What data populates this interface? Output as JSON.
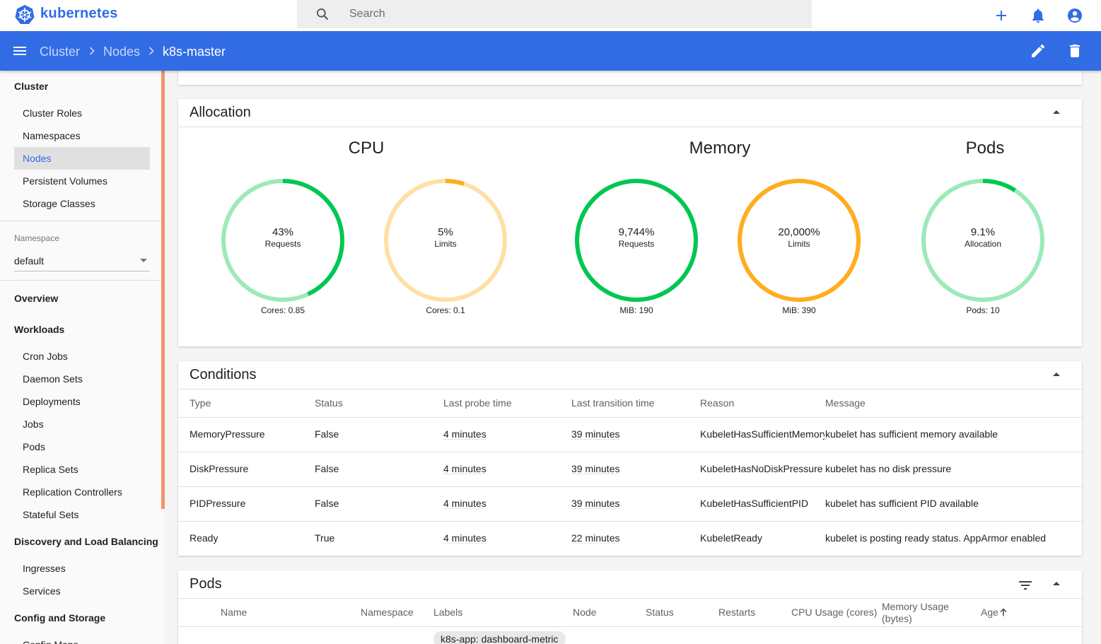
{
  "app": {
    "name": "kubernetes",
    "brand_color": "#326ce5"
  },
  "search": {
    "placeholder": "Search"
  },
  "topbar_icons": [
    "plus-icon",
    "bell-icon",
    "account-icon"
  ],
  "breadcrumb": {
    "items": [
      "Cluster",
      "Nodes"
    ],
    "current": "k8s-master"
  },
  "actions": [
    "edit-icon",
    "delete-icon"
  ],
  "sidebar": {
    "cluster": {
      "heading": "Cluster",
      "items": [
        "Cluster Roles",
        "Namespaces",
        "Nodes",
        "Persistent Volumes",
        "Storage Classes"
      ],
      "active": "Nodes"
    },
    "namespace": {
      "label": "Namespace",
      "value": "default"
    },
    "overview": "Overview",
    "workloads": {
      "heading": "Workloads",
      "items": [
        "Cron Jobs",
        "Daemon Sets",
        "Deployments",
        "Jobs",
        "Pods",
        "Replica Sets",
        "Replication Controllers",
        "Stateful Sets"
      ]
    },
    "discovery": {
      "heading": "Discovery and Load Balancing",
      "items": [
        "Ingresses",
        "Services"
      ]
    },
    "config": {
      "heading": "Config and Storage",
      "items": [
        "Config Maps"
      ]
    }
  },
  "allocation": {
    "title": "Allocation",
    "groups": [
      "CPU",
      "Memory",
      "Pods"
    ],
    "gauges": [
      {
        "value": "43%",
        "label": "Requests",
        "footer": "Cores: 0.85",
        "fraction": 0.43,
        "color": "#00c752",
        "track": "#9de9b9"
      },
      {
        "value": "5%",
        "label": "Limits",
        "footer": "Cores: 0.1",
        "fraction": 0.05,
        "color": "#ffad20",
        "track": "#ffdfa6"
      },
      {
        "value": "9,744%",
        "label": "Requests",
        "footer": "MiB: 190",
        "fraction": 1.0,
        "color": "#00c752",
        "track": "#9de9b9"
      },
      {
        "value": "20,000%",
        "label": "Limits",
        "footer": "MiB: 390",
        "fraction": 1.0,
        "color": "#ffad20",
        "track": "#ffdfa6"
      },
      {
        "value": "9.1%",
        "label": "Allocation",
        "footer": "Pods: 10",
        "fraction": 0.091,
        "color": "#00c752",
        "track": "#9de9b9"
      }
    ]
  },
  "conditions": {
    "title": "Conditions",
    "columns": [
      "Type",
      "Status",
      "Last probe time",
      "Last transition time",
      "Reason",
      "Message"
    ],
    "rows": [
      [
        "MemoryPressure",
        "False",
        "4 minutes",
        "39 minutes",
        "KubeletHasSufficientMemory",
        "kubelet has sufficient memory available"
      ],
      [
        "DiskPressure",
        "False",
        "4 minutes",
        "39 minutes",
        "KubeletHasNoDiskPressure",
        "kubelet has no disk pressure"
      ],
      [
        "PIDPressure",
        "False",
        "4 minutes",
        "39 minutes",
        "KubeletHasSufficientPID",
        "kubelet has sufficient PID available"
      ],
      [
        "Ready",
        "True",
        "4 minutes",
        "22 minutes",
        "KubeletReady",
        "kubelet is posting ready status. AppArmor enabled"
      ]
    ]
  },
  "pods": {
    "title": "Pods",
    "columns": [
      "Name",
      "Namespace",
      "Labels",
      "Node",
      "Status",
      "Restarts",
      "CPU Usage (cores)",
      "Memory Usage (bytes)",
      "Age"
    ],
    "first_label_chip": "k8s-app: dashboard-metric"
  }
}
